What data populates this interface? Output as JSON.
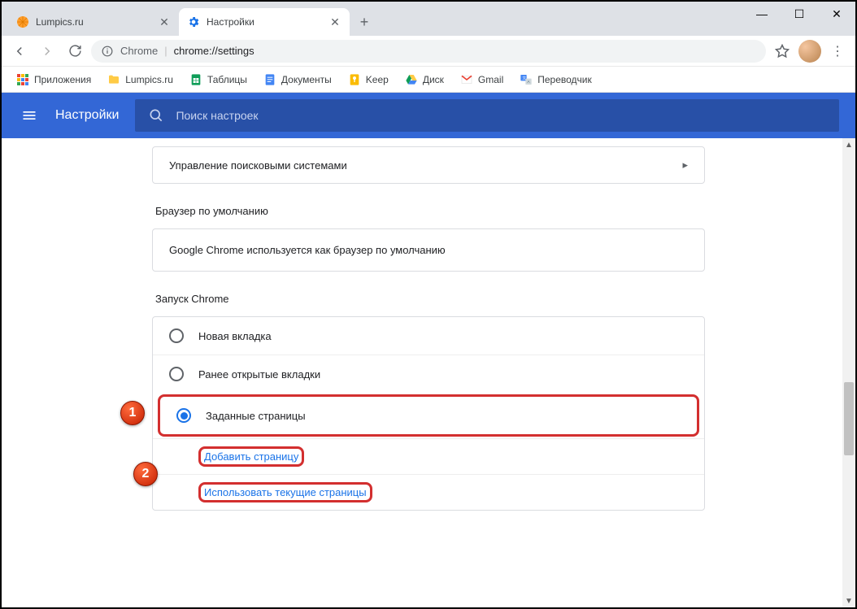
{
  "tabs": [
    {
      "title": "Lumpics.ru",
      "active": false
    },
    {
      "title": "Настройки",
      "active": true
    }
  ],
  "address": {
    "label": "Chrome",
    "url": "chrome://settings"
  },
  "bookmarks": [
    {
      "label": "Приложения"
    },
    {
      "label": "Lumpics.ru"
    },
    {
      "label": "Таблицы"
    },
    {
      "label": "Документы"
    },
    {
      "label": "Keep"
    },
    {
      "label": "Диск"
    },
    {
      "label": "Gmail"
    },
    {
      "label": "Переводчик"
    }
  ],
  "header": {
    "title": "Настройки",
    "search_placeholder": "Поиск настроек"
  },
  "sections": {
    "search_engines_row": "Управление поисковыми системами",
    "default_browser_title": "Браузер по умолчанию",
    "default_browser_text": "Google Chrome используется как браузер по умолчанию",
    "startup_title": "Запуск Chrome",
    "startup_options": [
      {
        "label": "Новая вкладка",
        "selected": false
      },
      {
        "label": "Ранее открытые вкладки",
        "selected": false
      },
      {
        "label": "Заданные страницы",
        "selected": true
      }
    ],
    "startup_links": {
      "add_page": "Добавить страницу",
      "use_current": "Использовать текущие страницы"
    }
  },
  "callouts": {
    "one": "1",
    "two": "2"
  }
}
